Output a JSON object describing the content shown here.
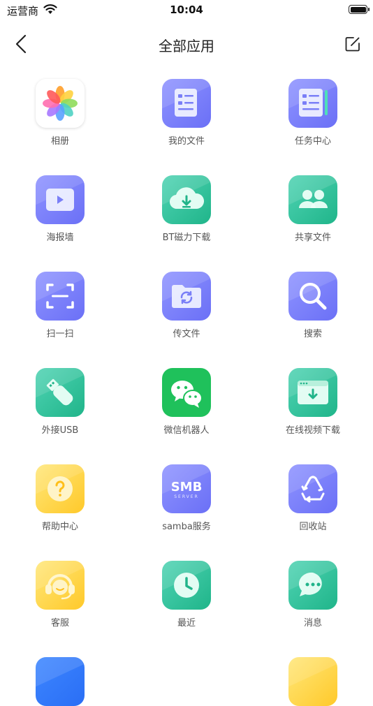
{
  "status_bar": {
    "carrier": "运营商",
    "time": "10:04"
  },
  "nav": {
    "title": "全部应用"
  },
  "apps": [
    {
      "label": "相册",
      "icon": "photos-icon"
    },
    {
      "label": "我的文件",
      "icon": "document-icon"
    },
    {
      "label": "任务中心",
      "icon": "task-list-icon"
    },
    {
      "label": "海报墙",
      "icon": "video-poster-icon"
    },
    {
      "label": "BT磁力下载",
      "icon": "cloud-download-icon"
    },
    {
      "label": "共享文件",
      "icon": "people-icon"
    },
    {
      "label": "扫一扫",
      "icon": "scan-icon"
    },
    {
      "label": "传文件",
      "icon": "folder-sync-icon"
    },
    {
      "label": "搜索",
      "icon": "search-icon"
    },
    {
      "label": "外接USB",
      "icon": "usb-icon"
    },
    {
      "label": "微信机器人",
      "icon": "wechat-icon"
    },
    {
      "label": "在线视频下载",
      "icon": "browser-download-icon"
    },
    {
      "label": "帮助中心",
      "icon": "help-icon"
    },
    {
      "label": "samba服务",
      "icon": "smb-icon",
      "badge": "SMB",
      "sub": "SERVER"
    },
    {
      "label": "回收站",
      "icon": "recycle-icon"
    },
    {
      "label": "客服",
      "icon": "headset-icon"
    },
    {
      "label": "最近",
      "icon": "clock-icon"
    },
    {
      "label": "消息",
      "icon": "message-icon"
    }
  ]
}
